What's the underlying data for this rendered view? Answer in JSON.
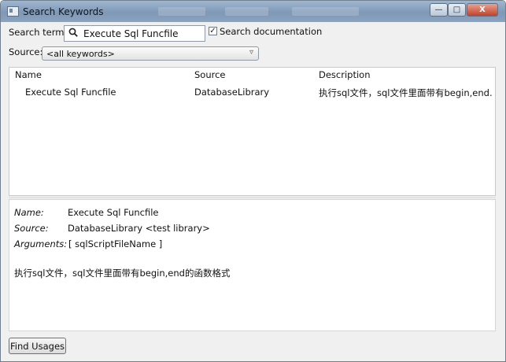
{
  "window": {
    "title": "Search Keywords",
    "controls": {
      "minimize": "—",
      "maximize": "□",
      "close": "X"
    }
  },
  "search": {
    "term_label": "Search term:",
    "term_value": "Execute Sql Funcfile",
    "search_doc_label": "Search documentation",
    "search_doc_checked": true,
    "source_label": "Source:",
    "source_value": "<all keywords>"
  },
  "results": {
    "columns": [
      "Name",
      "Source",
      "Description"
    ],
    "rows": [
      {
        "name": "Execute Sql Funcfile",
        "source": "DatabaseLibrary",
        "description": "执行sql文件，sql文件里面带有begin,end..."
      }
    ]
  },
  "details": {
    "name_label": "Name:",
    "name_value": "Execute Sql Funcfile",
    "source_label": "Source:",
    "source_value": "DatabaseLibrary <test library>",
    "arguments_label": "Arguments:",
    "arguments_value": "[ sqlScriptFileName ]",
    "documentation": "执行sql文件，sql文件里面带有begin,end的函数格式"
  },
  "footer": {
    "find_usages_label": "Find Usages"
  },
  "icons": {
    "app": "window-app-icon",
    "search": "magnifier-search-icon",
    "dropdown": "chevron-down-icon",
    "checkbox": "checkmark"
  },
  "colors": {
    "titlebar": "#8aa3c0",
    "close_button": "#c2412b",
    "panel": "#ffffff",
    "window_bg": "#f0f0f0"
  }
}
